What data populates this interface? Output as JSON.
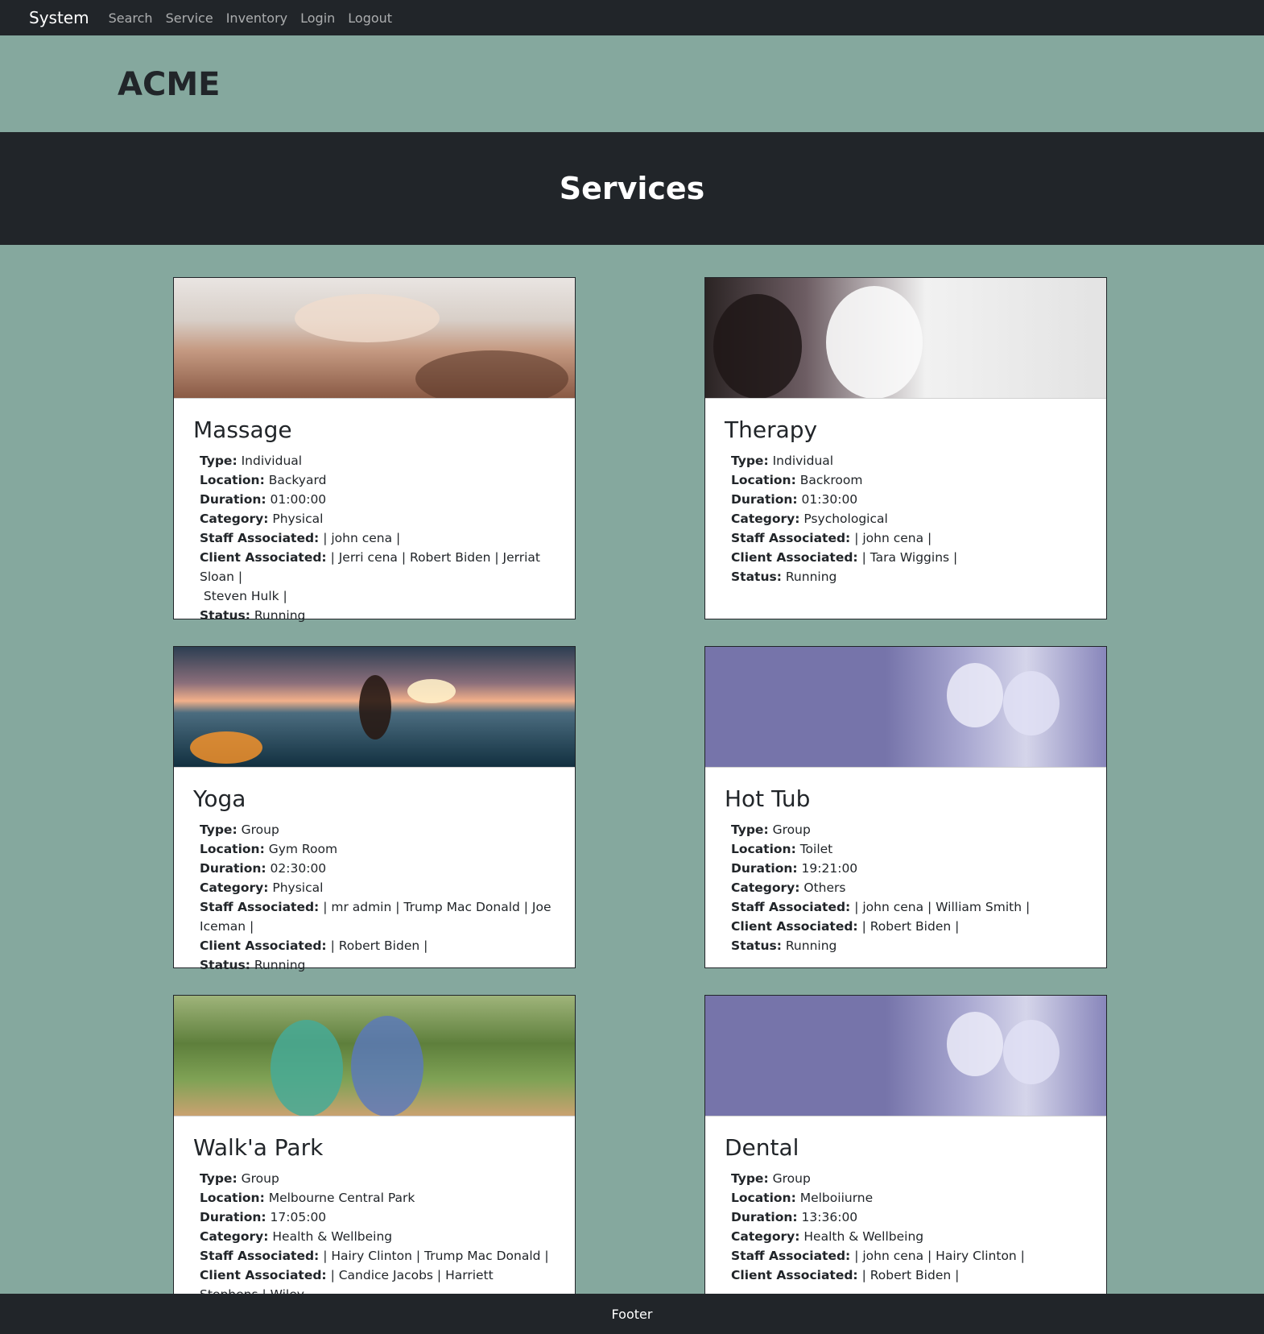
{
  "nav": {
    "brand": "System",
    "links": [
      "Search",
      "Service",
      "Inventory",
      "Login",
      "Logout"
    ]
  },
  "header": {
    "org": "ACME"
  },
  "page": {
    "title": "Services"
  },
  "labels": {
    "type": "Type:",
    "location": "Location:",
    "duration": "Duration:",
    "category": "Category:",
    "staff": "Staff Associated:",
    "client": "Client Associated:",
    "status": "Status:"
  },
  "services": [
    {
      "name": "Massage",
      "image": "massage-photo",
      "type": "Individual",
      "location": "Backyard",
      "duration": "01:00:00",
      "category": "Physical",
      "staff": "| john cena |",
      "client": "| Jerri cena | Robert Biden | Jerriat Sloan |",
      "client_cont": " Steven Hulk |",
      "status": "Running"
    },
    {
      "name": "Therapy",
      "image": "therapy-photo",
      "type": "Individual",
      "location": "Backroom",
      "duration": "01:30:00",
      "category": "Psychological",
      "staff": "| john cena |",
      "client": "| Tara Wiggins |",
      "client_cont": "",
      "status": "Running"
    },
    {
      "name": "Yoga",
      "image": "yoga-photo",
      "type": "Group",
      "location": "Gym Room",
      "duration": "02:30:00",
      "category": "Physical",
      "staff": "| mr admin | Trump Mac Donald | Joe Iceman |",
      "client": "| Robert Biden |",
      "client_cont": "",
      "status": "Running"
    },
    {
      "name": "Hot Tub",
      "image": "elderly-care-photo",
      "type": "Group",
      "location": "Toilet",
      "duration": "19:21:00",
      "category": "Others",
      "staff": "| john cena | William Smith |",
      "client": "| Robert Biden |",
      "client_cont": "",
      "status": "Running"
    },
    {
      "name": "Walk'a Park",
      "image": "park-walk-photo",
      "type": "Group",
      "location": "Melbourne Central Park",
      "duration": "17:05:00",
      "category": "Health & Wellbeing",
      "staff": "| Hairy Clinton | Trump Mac Donald |",
      "client": "| Candice Jacobs | Harriett Stephens | Wiley",
      "client_cont": "",
      "status": ""
    },
    {
      "name": "Dental",
      "image": "elderly-care-photo",
      "type": "Group",
      "location": "Melboiiurne",
      "duration": "13:36:00",
      "category": "Health & Wellbeing",
      "staff": "| john cena | Hairy Clinton |",
      "client": "| Robert Biden |",
      "client_cont": "",
      "status": ""
    }
  ],
  "footer": {
    "text": "Footer"
  }
}
